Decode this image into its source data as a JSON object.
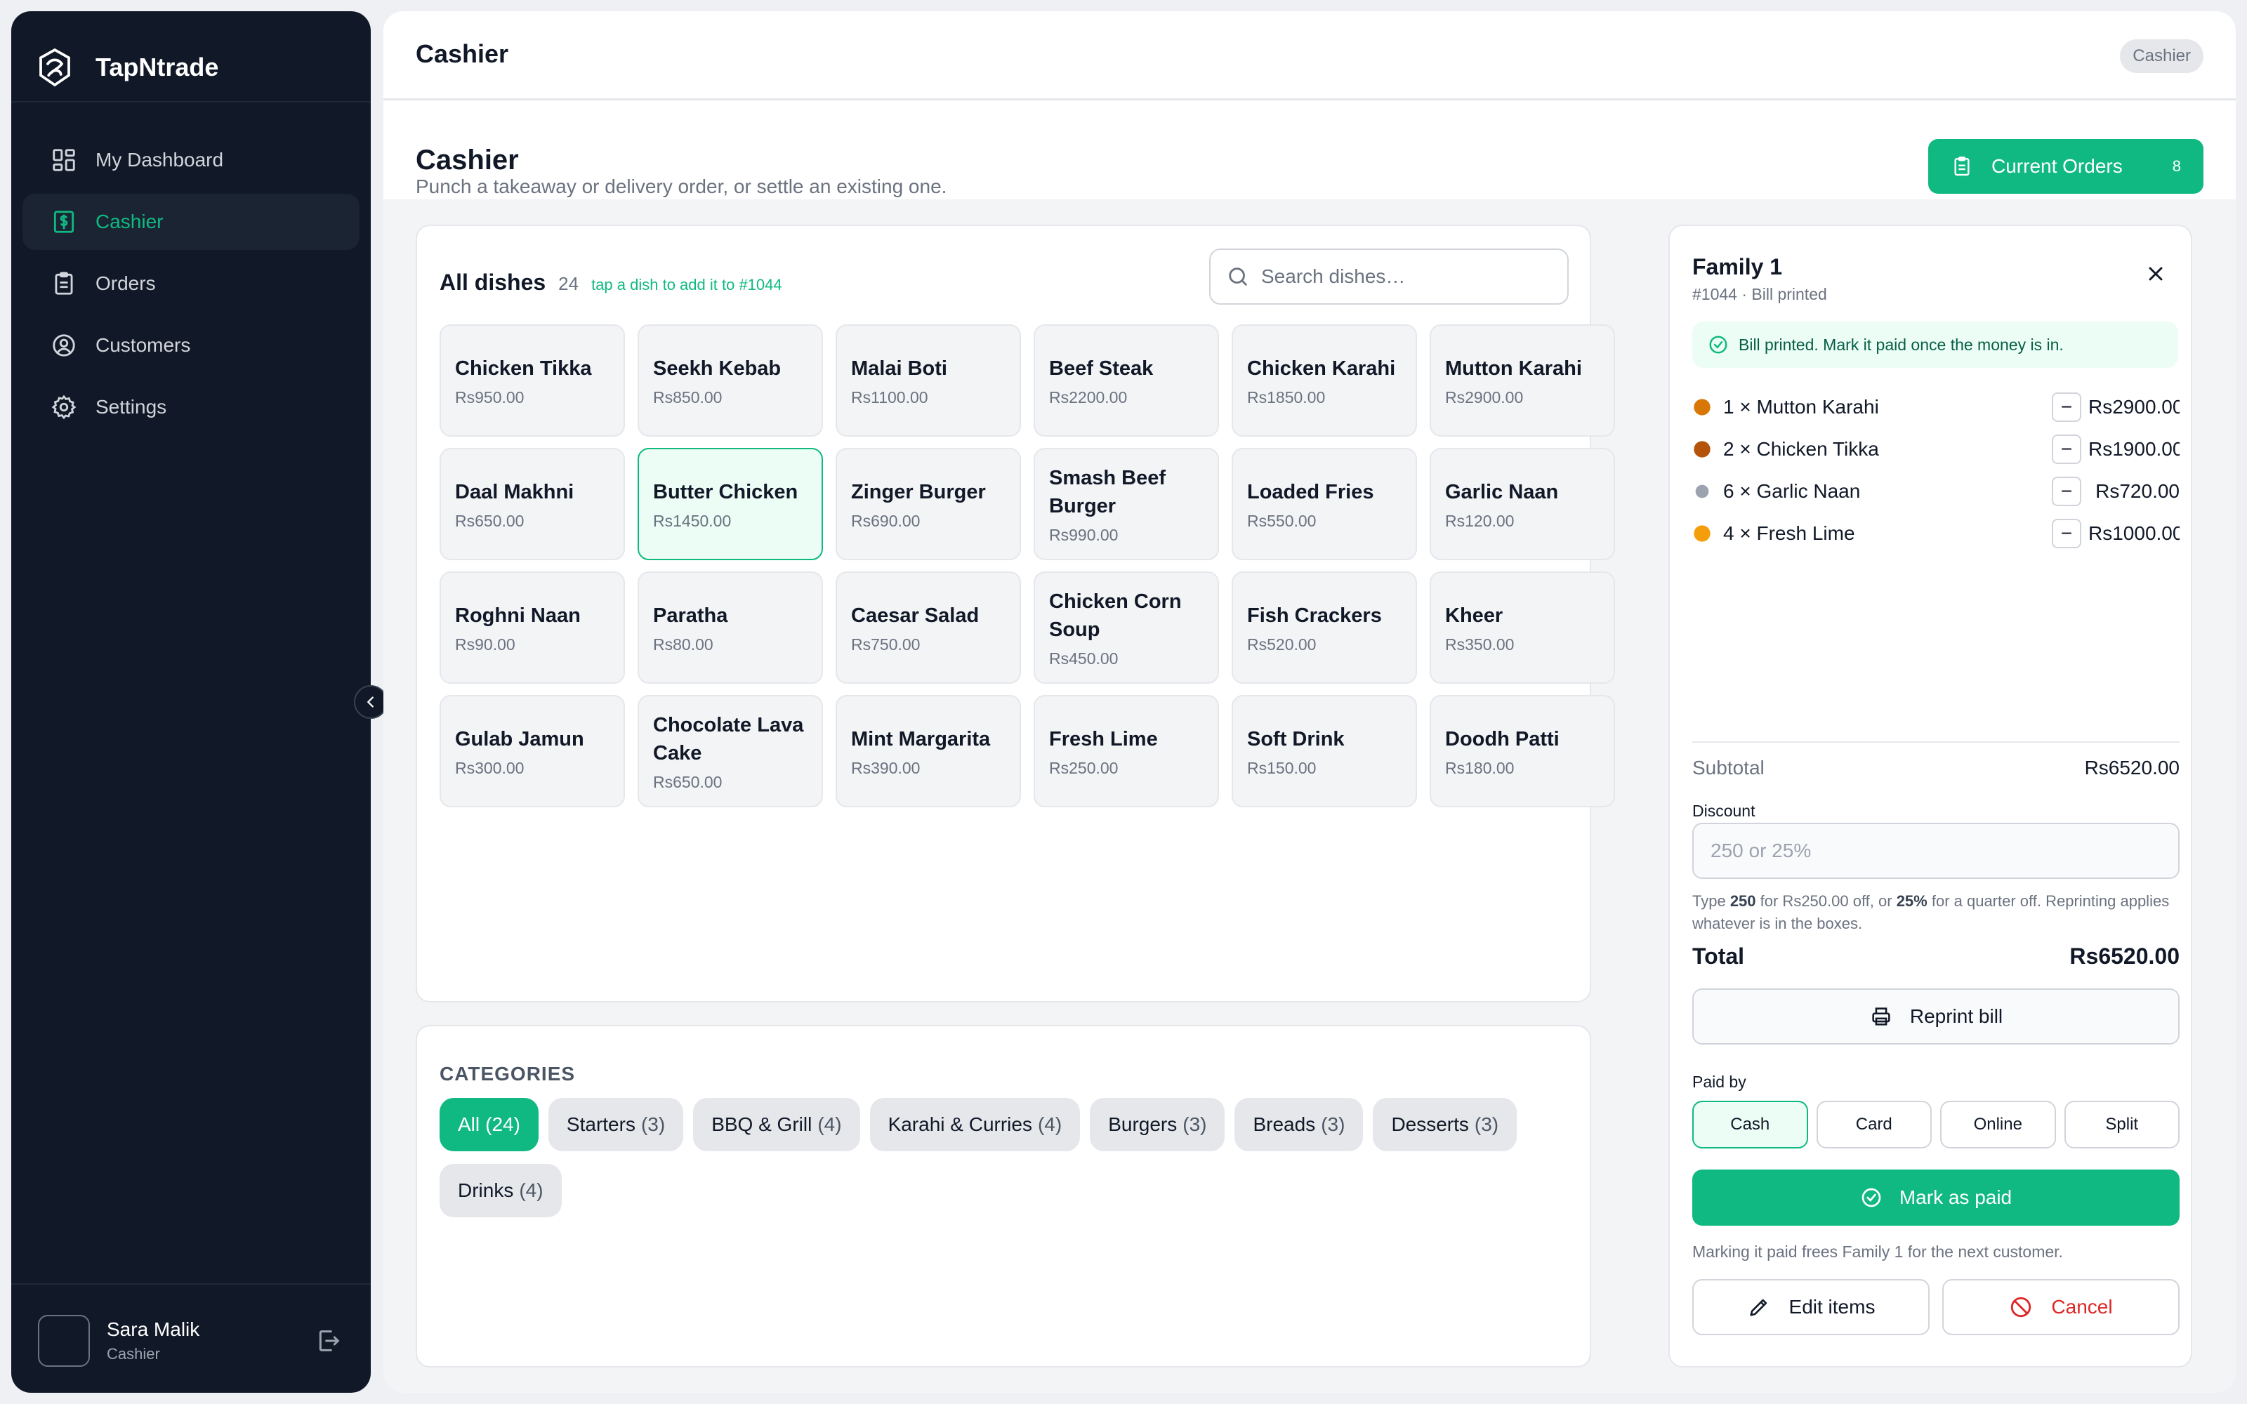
{
  "app": {
    "name": "TapNtrade"
  },
  "sidebar": {
    "items": [
      {
        "label": "My Dashboard",
        "icon": "dashboard-icon"
      },
      {
        "label": "Cashier",
        "icon": "cashier-icon",
        "active": true
      },
      {
        "label": "Orders",
        "icon": "orders-icon"
      },
      {
        "label": "Customers",
        "icon": "customers-icon"
      },
      {
        "label": "Settings",
        "icon": "settings-icon"
      }
    ],
    "user": {
      "name": "Sara Malik",
      "role": "Cashier"
    }
  },
  "topbar": {
    "title": "Cashier",
    "role_chip": "Cashier"
  },
  "page": {
    "heading": "Cashier",
    "subtitle": "Punch a takeaway or delivery order, or settle an existing one.",
    "current_orders": {
      "label": "Current Orders",
      "count": "8"
    }
  },
  "dishes": {
    "heading": "All dishes",
    "count": "24",
    "hint": "tap a dish to add it to #1044",
    "search_placeholder": "Search dishes…",
    "items": [
      {
        "name": "Chicken Tikka",
        "price": "Rs950.00"
      },
      {
        "name": "Seekh Kebab",
        "price": "Rs850.00"
      },
      {
        "name": "Malai Boti",
        "price": "Rs1100.00"
      },
      {
        "name": "Beef Steak",
        "price": "Rs2200.00"
      },
      {
        "name": "Chicken Karahi",
        "price": "Rs1850.00"
      },
      {
        "name": "Mutton Karahi",
        "price": "Rs2900.00"
      },
      {
        "name": "Daal Makhni",
        "price": "Rs650.00"
      },
      {
        "name": "Butter Chicken",
        "price": "Rs1450.00",
        "selected": true
      },
      {
        "name": "Zinger Burger",
        "price": "Rs690.00"
      },
      {
        "name": "Smash Beef Burger",
        "price": "Rs990.00"
      },
      {
        "name": "Loaded Fries",
        "price": "Rs550.00"
      },
      {
        "name": "Garlic Naan",
        "price": "Rs120.00"
      },
      {
        "name": "Roghni Naan",
        "price": "Rs90.00"
      },
      {
        "name": "Paratha",
        "price": "Rs80.00"
      },
      {
        "name": "Caesar Salad",
        "price": "Rs750.00"
      },
      {
        "name": "Chicken Corn Soup",
        "price": "Rs450.00"
      },
      {
        "name": "Fish Crackers",
        "price": "Rs520.00"
      },
      {
        "name": "Kheer",
        "price": "Rs350.00"
      },
      {
        "name": "Gulab Jamun",
        "price": "Rs300.00"
      },
      {
        "name": "Chocolate Lava Cake",
        "price": "Rs650.00"
      },
      {
        "name": "Mint Margarita",
        "price": "Rs390.00"
      },
      {
        "name": "Fresh Lime",
        "price": "Rs250.00"
      },
      {
        "name": "Soft Drink",
        "price": "Rs150.00"
      },
      {
        "name": "Doodh Patti",
        "price": "Rs180.00"
      }
    ]
  },
  "categories": {
    "heading": "CATEGORIES",
    "items": [
      {
        "label": "All",
        "count": "(24)",
        "active": true
      },
      {
        "label": "Starters",
        "count": "(3)"
      },
      {
        "label": "BBQ & Grill",
        "count": "(4)"
      },
      {
        "label": "Karahi & Curries",
        "count": "(4)"
      },
      {
        "label": "Burgers",
        "count": "(3)"
      },
      {
        "label": "Breads",
        "count": "(3)"
      },
      {
        "label": "Desserts",
        "count": "(3)"
      },
      {
        "label": "Drinks",
        "count": "(4)"
      }
    ]
  },
  "order": {
    "title": "Family 1",
    "subtitle": "#1044 · Bill printed",
    "notice": "Bill printed. Mark it paid once the money is in.",
    "lines": [
      {
        "label": "1 × Mutton Karahi",
        "price": "Rs2900.00",
        "icon": "curry-bowl-icon",
        "color": "#d97706"
      },
      {
        "label": "2 × Chicken Tikka",
        "price": "Rs1900.00",
        "icon": "drumstick-icon",
        "color": "#b45309"
      },
      {
        "label": "6 × Garlic Naan",
        "price": "Rs720.00",
        "icon": "naan-icon",
        "color": "#9ca3af"
      },
      {
        "label": "4 × Fresh Lime",
        "price": "Rs1000.00",
        "icon": "lime-icon",
        "color": "#f59e0b"
      }
    ],
    "subtotal_label": "Subtotal",
    "subtotal": "Rs6520.00",
    "discount_label": "Discount",
    "discount_placeholder": "250 or 25%",
    "discount_help": {
      "p1": "Type ",
      "b1": "250",
      "p2": " for Rs250.00 off, or ",
      "b2": "25%",
      "p3": " for a quarter off. Reprinting applies whatever is in the boxes."
    },
    "total_label": "Total",
    "total": "Rs6520.00",
    "reprint_label": "Reprint bill",
    "paid_by_label": "Paid by",
    "payment_methods": [
      {
        "label": "Cash",
        "active": true
      },
      {
        "label": "Card"
      },
      {
        "label": "Online"
      },
      {
        "label": "Split"
      }
    ],
    "mark_paid_label": "Mark as paid",
    "paid_note": "Marking it paid frees Family 1 for the next customer.",
    "edit_label": "Edit items",
    "cancel_label": "Cancel"
  },
  "colors": {
    "accent": "#10b981",
    "sidebar_bg": "#111827",
    "danger": "#dc2626"
  }
}
